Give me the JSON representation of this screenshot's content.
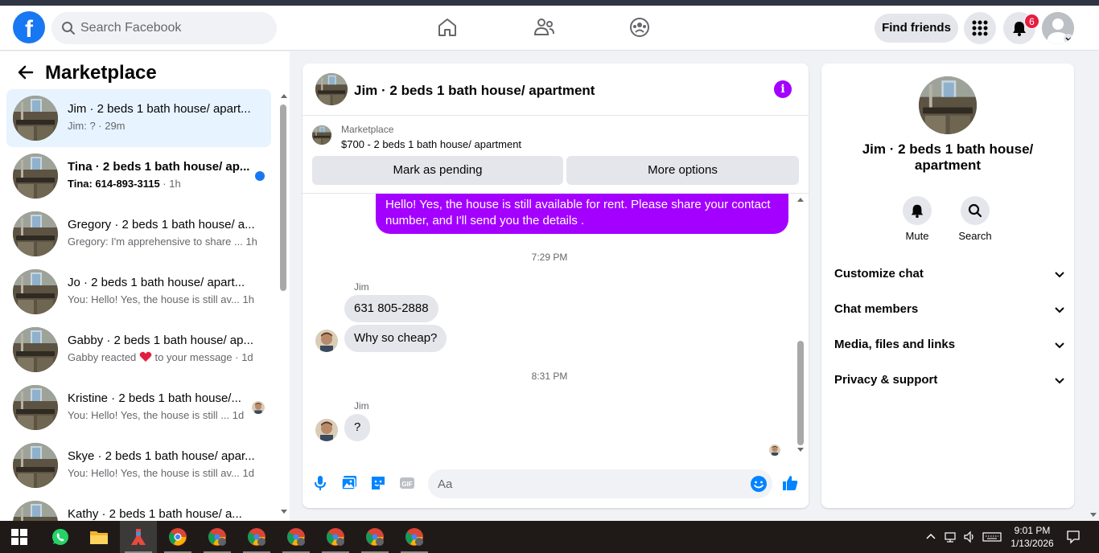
{
  "navbar": {
    "search_placeholder": "Search Facebook",
    "find_friends": "Find friends",
    "notification_count": "6",
    "logo_letter": "f",
    "brand_color": "#1877f2"
  },
  "sidebar": {
    "title": "Marketplace",
    "conversations": [
      {
        "name": "Jim · 2 beds 1 bath house/ apart...",
        "preview": "Jim: ? · 29m",
        "active": true
      },
      {
        "name": "Tina · 2 beds 1 bath house/ ap...",
        "preview_sender": "Tina: 614-893-3115",
        "preview_time": " · 1h",
        "unread": true
      },
      {
        "name": "Gregory · 2 beds 1 bath house/ a...",
        "preview": "Gregory: I'm apprehensive to share ...",
        "time": "1h"
      },
      {
        "name": "Jo · 2 beds 1 bath house/ apart...",
        "preview": "You: Hello! Yes, the house is still av...",
        "time": "1h"
      },
      {
        "name": "Gabby · 2 beds 1 bath house/ ap...",
        "preview_a": "Gabby reacted",
        "preview_b": "to your message · 1d",
        "reaction_icon": "heart-icon"
      },
      {
        "name": "Kristine · 2 beds 1 bath house/...",
        "preview": "You: Hello! Yes, the house is still ...",
        "time": "1d"
      },
      {
        "name": "Skye · 2 beds 1 bath house/ apar...",
        "preview": "You: Hello! Yes, the house is still av...",
        "time": "1d"
      },
      {
        "name": "Kathy · 2 beds 1 bath house/ a..."
      }
    ]
  },
  "chat": {
    "title": "Jim · 2 beds 1 bath house/ apartment",
    "marketplace_label": "Marketplace",
    "listing": "$700 - 2 beds 1 bath house/ apartment",
    "mark_pending": "Mark as pending",
    "more_options": "More options",
    "outgoing_message": "Hello! Yes, the house is still available for rent. Please share your contact number, and I'll send you the details .",
    "timestamp_1": "7:29 PM",
    "sender_1": "Jim",
    "incoming_1a": "631 805-2888",
    "incoming_1b": "Why so cheap?",
    "timestamp_2": "8:31 PM",
    "sender_2": "Jim",
    "incoming_2": "?",
    "composer_placeholder": "Aa",
    "accent_color": "#a400ff"
  },
  "info_panel": {
    "title": "Jim · 2 beds 1 bath house/ apartment",
    "mute": "Mute",
    "search": "Search",
    "rows": [
      "Customize chat",
      "Chat members",
      "Media, files and links",
      "Privacy & support"
    ]
  },
  "taskbar": {
    "time": "9:01 PM",
    "date": "1/13/2026"
  }
}
